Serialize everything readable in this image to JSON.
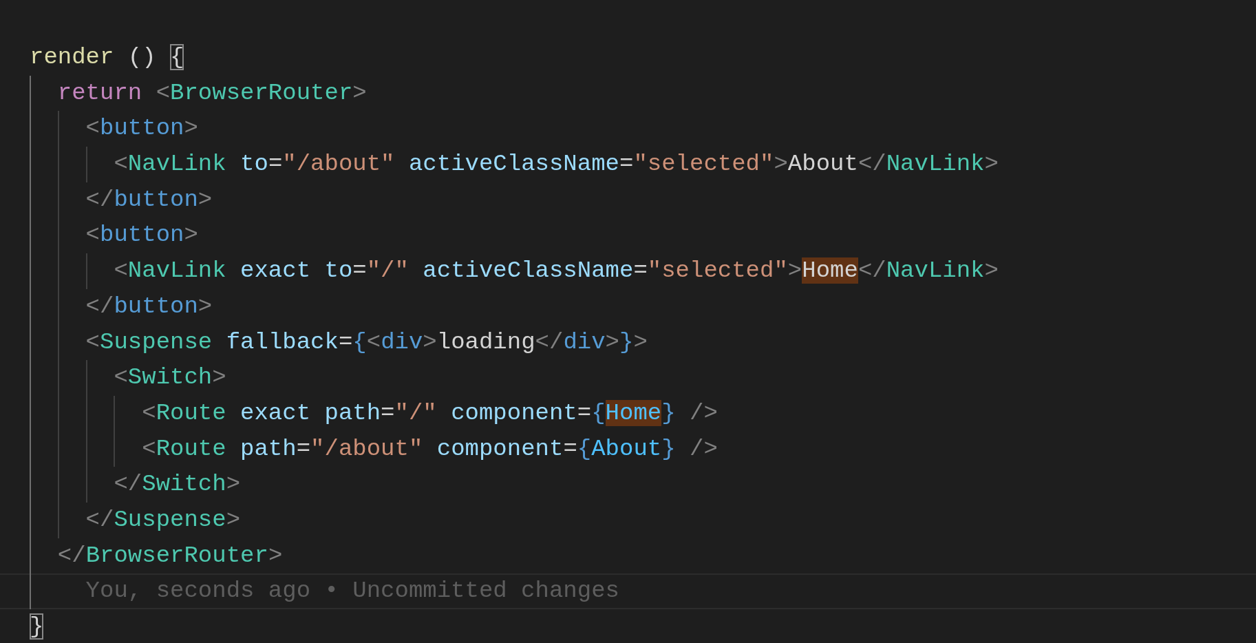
{
  "editor": {
    "lines": [
      {
        "kind": "code",
        "tokens": [
          {
            "text": "render",
            "kind": "fn"
          },
          {
            "text": " () ",
            "kind": "plain"
          },
          {
            "text": "{",
            "kind": "plain",
            "bracket_match": true
          }
        ]
      },
      {
        "kind": "code",
        "tokens": [
          {
            "text": "  return ",
            "kind": "keyword"
          },
          {
            "text": "<",
            "kind": "angle"
          },
          {
            "text": "BrowserRouter",
            "kind": "comp"
          },
          {
            "text": ">",
            "kind": "angle"
          }
        ]
      },
      {
        "kind": "code",
        "tokens": [
          {
            "text": "    <",
            "kind": "angle"
          },
          {
            "text": "button",
            "kind": "tag"
          },
          {
            "text": ">",
            "kind": "angle"
          }
        ]
      },
      {
        "kind": "code",
        "tokens": [
          {
            "text": "      <",
            "kind": "angle"
          },
          {
            "text": "NavLink ",
            "kind": "comp"
          },
          {
            "text": "to",
            "kind": "attr"
          },
          {
            "text": "=",
            "kind": "plain"
          },
          {
            "text": "\"/about\" ",
            "kind": "string"
          },
          {
            "text": "activeClassName",
            "kind": "attr"
          },
          {
            "text": "=",
            "kind": "plain"
          },
          {
            "text": "\"selected\"",
            "kind": "string"
          },
          {
            "text": ">",
            "kind": "angle"
          },
          {
            "text": "About",
            "kind": "plain"
          },
          {
            "text": "</",
            "kind": "angle"
          },
          {
            "text": "NavLink",
            "kind": "comp"
          },
          {
            "text": ">",
            "kind": "angle"
          }
        ]
      },
      {
        "kind": "code",
        "tokens": [
          {
            "text": "    </",
            "kind": "angle"
          },
          {
            "text": "button",
            "kind": "tag"
          },
          {
            "text": ">",
            "kind": "angle"
          }
        ]
      },
      {
        "kind": "code",
        "tokens": [
          {
            "text": "    <",
            "kind": "angle"
          },
          {
            "text": "button",
            "kind": "tag"
          },
          {
            "text": ">",
            "kind": "angle"
          }
        ]
      },
      {
        "kind": "code",
        "tokens": [
          {
            "text": "      <",
            "kind": "angle"
          },
          {
            "text": "NavLink ",
            "kind": "comp"
          },
          {
            "text": "exact to",
            "kind": "attr"
          },
          {
            "text": "=",
            "kind": "plain"
          },
          {
            "text": "\"/\" ",
            "kind": "string"
          },
          {
            "text": "activeClassName",
            "kind": "attr"
          },
          {
            "text": "=",
            "kind": "plain"
          },
          {
            "text": "\"selected\"",
            "kind": "string"
          },
          {
            "text": ">",
            "kind": "angle"
          },
          {
            "text": "Home",
            "kind": "plain",
            "word_highlight": true
          },
          {
            "text": "</",
            "kind": "angle"
          },
          {
            "text": "NavLink",
            "kind": "comp"
          },
          {
            "text": ">",
            "kind": "angle"
          }
        ]
      },
      {
        "kind": "code",
        "tokens": [
          {
            "text": "    </",
            "kind": "angle"
          },
          {
            "text": "button",
            "kind": "tag"
          },
          {
            "text": ">",
            "kind": "angle"
          }
        ]
      },
      {
        "kind": "code",
        "tokens": [
          {
            "text": "    <",
            "kind": "angle"
          },
          {
            "text": "Suspense ",
            "kind": "comp"
          },
          {
            "text": "fallback",
            "kind": "attr"
          },
          {
            "text": "=",
            "kind": "plain"
          },
          {
            "text": "{",
            "kind": "brace"
          },
          {
            "text": "<",
            "kind": "angle"
          },
          {
            "text": "div",
            "kind": "tag"
          },
          {
            "text": ">",
            "kind": "angle"
          },
          {
            "text": "loading",
            "kind": "plain"
          },
          {
            "text": "</",
            "kind": "angle"
          },
          {
            "text": "div",
            "kind": "tag"
          },
          {
            "text": ">",
            "kind": "angle"
          },
          {
            "text": "}",
            "kind": "brace"
          },
          {
            "text": ">",
            "kind": "angle"
          }
        ]
      },
      {
        "kind": "code",
        "tokens": [
          {
            "text": "      <",
            "kind": "angle"
          },
          {
            "text": "Switch",
            "kind": "comp"
          },
          {
            "text": ">",
            "kind": "angle"
          }
        ]
      },
      {
        "kind": "code",
        "tokens": [
          {
            "text": "        <",
            "kind": "angle"
          },
          {
            "text": "Route ",
            "kind": "comp"
          },
          {
            "text": "exact path",
            "kind": "attr"
          },
          {
            "text": "=",
            "kind": "plain"
          },
          {
            "text": "\"/\" ",
            "kind": "string"
          },
          {
            "text": "component",
            "kind": "attr"
          },
          {
            "text": "=",
            "kind": "plain"
          },
          {
            "text": "{",
            "kind": "brace"
          },
          {
            "text": "Home",
            "kind": "var",
            "word_highlight": true
          },
          {
            "text": "}",
            "kind": "brace"
          },
          {
            "text": " />",
            "kind": "angle"
          }
        ]
      },
      {
        "kind": "code",
        "tokens": [
          {
            "text": "        <",
            "kind": "angle"
          },
          {
            "text": "Route ",
            "kind": "comp"
          },
          {
            "text": "path",
            "kind": "attr"
          },
          {
            "text": "=",
            "kind": "plain"
          },
          {
            "text": "\"/about\" ",
            "kind": "string"
          },
          {
            "text": "component",
            "kind": "attr"
          },
          {
            "text": "=",
            "kind": "plain"
          },
          {
            "text": "{",
            "kind": "brace"
          },
          {
            "text": "About",
            "kind": "var"
          },
          {
            "text": "}",
            "kind": "brace"
          },
          {
            "text": " />",
            "kind": "angle"
          }
        ]
      },
      {
        "kind": "code",
        "tokens": [
          {
            "text": "      </",
            "kind": "angle"
          },
          {
            "text": "Switch",
            "kind": "comp"
          },
          {
            "text": ">",
            "kind": "angle"
          }
        ]
      },
      {
        "kind": "code",
        "tokens": [
          {
            "text": "    </",
            "kind": "angle"
          },
          {
            "text": "Suspense",
            "kind": "comp"
          },
          {
            "text": ">",
            "kind": "angle"
          }
        ]
      },
      {
        "kind": "code",
        "tokens": [
          {
            "text": "  </",
            "kind": "angle"
          },
          {
            "text": "BrowserRouter",
            "kind": "comp"
          },
          {
            "text": ">",
            "kind": "angle"
          }
        ]
      },
      {
        "kind": "blame",
        "tokens": [
          {
            "text": "    You, seconds ago • Uncommitted changes",
            "kind": "blame"
          }
        ]
      },
      {
        "kind": "code",
        "tokens": [
          {
            "text": "}",
            "kind": "plain",
            "bracket_match": true
          }
        ]
      }
    ]
  }
}
